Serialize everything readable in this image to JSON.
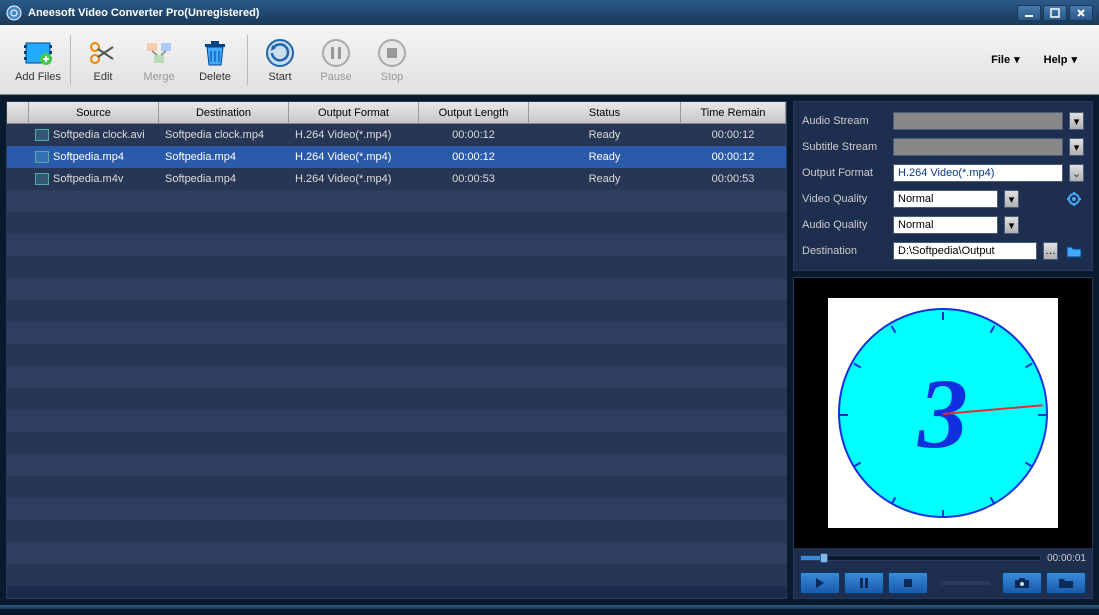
{
  "title": "Aneesoft Video Converter Pro(Unregistered)",
  "toolbar": {
    "add_files": "Add Files",
    "edit": "Edit",
    "merge": "Merge",
    "delete": "Delete",
    "start": "Start",
    "pause": "Pause",
    "stop": "Stop"
  },
  "menus": {
    "file": "File",
    "help": "Help"
  },
  "columns": {
    "source": "Source",
    "destination": "Destination",
    "output_format": "Output Format",
    "output_length": "Output Length",
    "status": "Status",
    "time_remain": "Time Remain"
  },
  "rows": [
    {
      "source": "Softpedia clock.avi",
      "destination": "Softpedia clock.mp4",
      "format": "H.264 Video(*.mp4)",
      "length": "00:00:12",
      "status": "Ready",
      "remain": "00:00:12",
      "selected": false
    },
    {
      "source": "Softpedia.mp4",
      "destination": "Softpedia.mp4",
      "format": "H.264 Video(*.mp4)",
      "length": "00:00:12",
      "status": "Ready",
      "remain": "00:00:12",
      "selected": true
    },
    {
      "source": "Softpedia.m4v",
      "destination": "Softpedia.mp4",
      "format": "H.264 Video(*.mp4)",
      "length": "00:00:53",
      "status": "Ready",
      "remain": "00:00:53",
      "selected": false
    }
  ],
  "settings": {
    "audio_stream_label": "Audio Stream",
    "audio_stream_value": "",
    "subtitle_stream_label": "Subtitle Stream",
    "subtitle_stream_value": "",
    "output_format_label": "Output Format",
    "output_format_value": "H.264 Video(*.mp4)",
    "video_quality_label": "Video Quality",
    "video_quality_value": "Normal",
    "audio_quality_label": "Audio Quality",
    "audio_quality_value": "Normal",
    "destination_label": "Destination",
    "destination_value": "D:\\Softpedia\\Output"
  },
  "preview": {
    "time": "00:00:01",
    "digit": "3"
  }
}
